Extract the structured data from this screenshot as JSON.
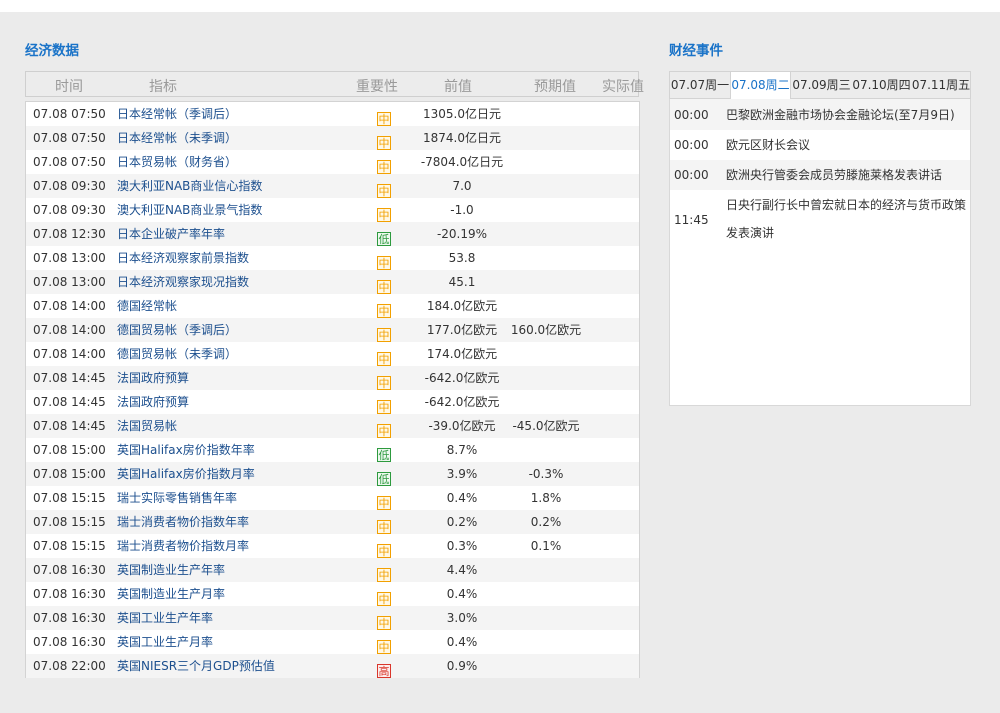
{
  "economic": {
    "title": "经济数据",
    "headers": {
      "time": "时间",
      "indicator": "指标",
      "importance": "重要性",
      "previous": "前值",
      "forecast": "预期值",
      "actual": "实际值"
    },
    "rows": [
      {
        "time": "07.08 07:50",
        "name": "日本经常帐（季调后）",
        "imp": "中",
        "level": "mid",
        "prev": "1305.0亿日元",
        "fore": "",
        "act": ""
      },
      {
        "time": "07.08 07:50",
        "name": "日本经常帐（未季调）",
        "imp": "中",
        "level": "mid",
        "prev": "1874.0亿日元",
        "fore": "",
        "act": ""
      },
      {
        "time": "07.08 07:50",
        "name": "日本贸易帐（财务省）",
        "imp": "中",
        "level": "mid",
        "prev": "-7804.0亿日元",
        "fore": "",
        "act": ""
      },
      {
        "time": "07.08 09:30",
        "name": "澳大利亚NAB商业信心指数",
        "imp": "中",
        "level": "mid",
        "prev": "7.0",
        "fore": "",
        "act": ""
      },
      {
        "time": "07.08 09:30",
        "name": "澳大利亚NAB商业景气指数",
        "imp": "中",
        "level": "mid",
        "prev": "-1.0",
        "fore": "",
        "act": ""
      },
      {
        "time": "07.08 12:30",
        "name": "日本企业破产率年率",
        "imp": "低",
        "level": "low",
        "prev": "-20.19%",
        "fore": "",
        "act": ""
      },
      {
        "time": "07.08 13:00",
        "name": "日本经济观察家前景指数",
        "imp": "中",
        "level": "mid",
        "prev": "53.8",
        "fore": "",
        "act": ""
      },
      {
        "time": "07.08 13:00",
        "name": "日本经济观察家现况指数",
        "imp": "中",
        "level": "mid",
        "prev": "45.1",
        "fore": "",
        "act": ""
      },
      {
        "time": "07.08 14:00",
        "name": "德国经常帐",
        "imp": "中",
        "level": "mid",
        "prev": "184.0亿欧元",
        "fore": "",
        "act": ""
      },
      {
        "time": "07.08 14:00",
        "name": "德国贸易帐（季调后）",
        "imp": "中",
        "level": "mid",
        "prev": "177.0亿欧元",
        "fore": "160.0亿欧元",
        "act": ""
      },
      {
        "time": "07.08 14:00",
        "name": "德国贸易帐（未季调）",
        "imp": "中",
        "level": "mid",
        "prev": "174.0亿欧元",
        "fore": "",
        "act": ""
      },
      {
        "time": "07.08 14:45",
        "name": "法国政府预算",
        "imp": "中",
        "level": "mid",
        "prev": "-642.0亿欧元",
        "fore": "",
        "act": ""
      },
      {
        "time": "07.08 14:45",
        "name": "法国政府预算",
        "imp": "中",
        "level": "mid",
        "prev": "-642.0亿欧元",
        "fore": "",
        "act": ""
      },
      {
        "time": "07.08 14:45",
        "name": "法国贸易帐",
        "imp": "中",
        "level": "mid",
        "prev": "-39.0亿欧元",
        "fore": "-45.0亿欧元",
        "act": ""
      },
      {
        "time": "07.08 15:00",
        "name": "英国Halifax房价指数年率",
        "imp": "低",
        "level": "low",
        "prev": "8.7%",
        "fore": "",
        "act": ""
      },
      {
        "time": "07.08 15:00",
        "name": "英国Halifax房价指数月率",
        "imp": "低",
        "level": "low",
        "prev": "3.9%",
        "fore": "-0.3%",
        "act": ""
      },
      {
        "time": "07.08 15:15",
        "name": "瑞士实际零售销售年率",
        "imp": "中",
        "level": "mid",
        "prev": "0.4%",
        "fore": "1.8%",
        "act": ""
      },
      {
        "time": "07.08 15:15",
        "name": "瑞士消费者物价指数年率",
        "imp": "中",
        "level": "mid",
        "prev": "0.2%",
        "fore": "0.2%",
        "act": ""
      },
      {
        "time": "07.08 15:15",
        "name": "瑞士消费者物价指数月率",
        "imp": "中",
        "level": "mid",
        "prev": "0.3%",
        "fore": "0.1%",
        "act": ""
      },
      {
        "time": "07.08 16:30",
        "name": "英国制造业生产年率",
        "imp": "中",
        "level": "mid",
        "prev": "4.4%",
        "fore": "",
        "act": ""
      },
      {
        "time": "07.08 16:30",
        "name": "英国制造业生产月率",
        "imp": "中",
        "level": "mid",
        "prev": "0.4%",
        "fore": "",
        "act": ""
      },
      {
        "time": "07.08 16:30",
        "name": "英国工业生产年率",
        "imp": "中",
        "level": "mid",
        "prev": "3.0%",
        "fore": "",
        "act": ""
      },
      {
        "time": "07.08 16:30",
        "name": "英国工业生产月率",
        "imp": "中",
        "level": "mid",
        "prev": "0.4%",
        "fore": "",
        "act": ""
      },
      {
        "time": "07.08 22:00",
        "name": "英国NIESR三个月GDP预估值",
        "imp": "高",
        "level": "high",
        "prev": "0.9%",
        "fore": "",
        "act": ""
      }
    ]
  },
  "events": {
    "title": "财经事件",
    "tabs": [
      {
        "label": "07.07周一",
        "active": false
      },
      {
        "label": "07.08周二",
        "active": true
      },
      {
        "label": "07.09周三",
        "active": false
      },
      {
        "label": "07.10周四",
        "active": false
      },
      {
        "label": "07.11周五",
        "active": false
      }
    ],
    "items": [
      {
        "time": "00:00",
        "text": "巴黎欧洲金融市场协会金融论坛(至7月9日)"
      },
      {
        "time": "00:00",
        "text": "欧元区财长会议"
      },
      {
        "time": "00:00",
        "text": "欧洲央行管委会成员劳滕施莱格发表讲话"
      },
      {
        "time": "11:45",
        "text": "日央行副行长中曾宏就日本的经济与货币政策发表演讲"
      }
    ]
  }
}
